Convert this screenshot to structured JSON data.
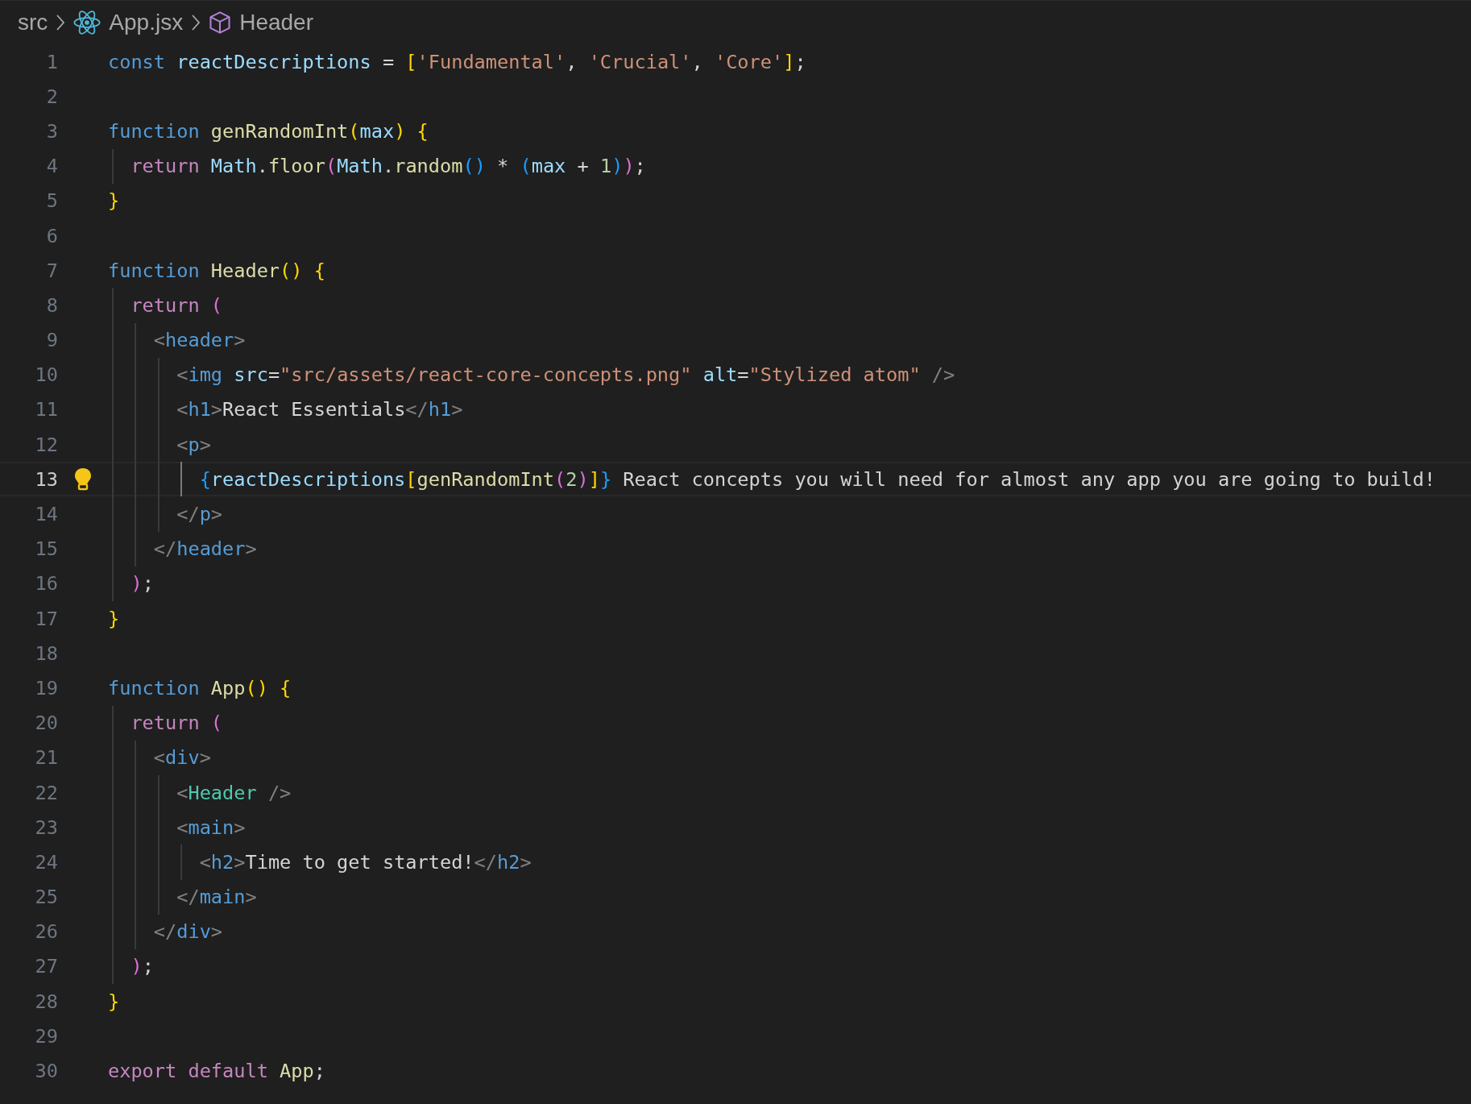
{
  "breadcrumb": [
    {
      "label": "src",
      "kind": "folder"
    },
    {
      "label": "App.jsx",
      "kind": "react-file"
    },
    {
      "label": "Header",
      "kind": "symbol"
    }
  ],
  "lines": [
    {
      "number": "1",
      "current": false,
      "lightbulb": false,
      "tokens": [
        {
          "text": "const ",
          "kind": "kw"
        },
        {
          "text": "reactDescriptions",
          "kind": "var"
        },
        {
          "text": " = ",
          "kind": "op"
        },
        {
          "text": "[",
          "kind": "b1"
        },
        {
          "text": "'Fundamental'",
          "kind": "str"
        },
        {
          "text": ", ",
          "kind": "op"
        },
        {
          "text": "'Crucial'",
          "kind": "str"
        },
        {
          "text": ", ",
          "kind": "op"
        },
        {
          "text": "'Core'",
          "kind": "str"
        },
        {
          "text": "]",
          "kind": "b1"
        },
        {
          "text": ";",
          "kind": "op"
        }
      ]
    },
    {
      "number": "2",
      "current": false,
      "lightbulb": false
    },
    {
      "number": "3",
      "current": false,
      "lightbulb": false,
      "tokens": [
        {
          "text": "function ",
          "kind": "kw"
        },
        {
          "text": "genRandomInt",
          "kind": "fn"
        },
        {
          "text": "(",
          "kind": "b1"
        },
        {
          "text": "max",
          "kind": "var"
        },
        {
          "text": ") {",
          "kind": "b1"
        }
      ]
    },
    {
      "number": "4",
      "current": false,
      "lightbulb": false,
      "tokens": [
        {
          "text": "  return ",
          "kind": "ctl"
        },
        {
          "text": "Math",
          "kind": "var"
        },
        {
          "text": ".",
          "kind": "op"
        },
        {
          "text": "floor",
          "kind": "fn"
        },
        {
          "text": "(",
          "kind": "b2"
        },
        {
          "text": "Math",
          "kind": "var"
        },
        {
          "text": ".",
          "kind": "op"
        },
        {
          "text": "random",
          "kind": "fn"
        },
        {
          "text": "()",
          "kind": "b3"
        },
        {
          "text": " * ",
          "kind": "op"
        },
        {
          "text": "(",
          "kind": "b3"
        },
        {
          "text": "max",
          "kind": "var"
        },
        {
          "text": " + ",
          "kind": "op"
        },
        {
          "text": "1",
          "kind": "num"
        },
        {
          "text": ")",
          "kind": "b3"
        },
        {
          "text": ")",
          "kind": "b2"
        },
        {
          "text": ";",
          "kind": "op"
        }
      ]
    },
    {
      "number": "5",
      "current": false,
      "lightbulb": false,
      "tokens": [
        {
          "text": "}",
          "kind": "b1"
        }
      ]
    },
    {
      "number": "6",
      "current": false,
      "lightbulb": false
    },
    {
      "number": "7",
      "current": false,
      "lightbulb": false,
      "tokens": [
        {
          "text": "function ",
          "kind": "kw"
        },
        {
          "text": "Header",
          "kind": "fn"
        },
        {
          "text": "() {",
          "kind": "b1"
        }
      ]
    },
    {
      "number": "8",
      "current": false,
      "lightbulb": false,
      "tokens": [
        {
          "text": "  return ",
          "kind": "ctl"
        },
        {
          "text": "(",
          "kind": "b2"
        }
      ]
    },
    {
      "number": "9",
      "current": false,
      "lightbulb": false,
      "tokens": [
        {
          "text": "    <",
          "kind": "tb"
        },
        {
          "text": "header",
          "kind": "tag"
        },
        {
          "text": ">",
          "kind": "tb"
        }
      ]
    },
    {
      "number": "10",
      "current": false,
      "lightbulb": false,
      "tokens": [
        {
          "text": "      <",
          "kind": "tb"
        },
        {
          "text": "img",
          "kind": "tag"
        },
        {
          "text": " src",
          "kind": "attr"
        },
        {
          "text": "=",
          "kind": "op"
        },
        {
          "text": "\"src/assets/react-core-concepts.png\"",
          "kind": "str"
        },
        {
          "text": " alt",
          "kind": "attr"
        },
        {
          "text": "=",
          "kind": "op"
        },
        {
          "text": "\"Stylized atom\"",
          "kind": "str"
        },
        {
          "text": " />",
          "kind": "tb"
        }
      ]
    },
    {
      "number": "11",
      "current": false,
      "lightbulb": false,
      "tokens": [
        {
          "text": "      <",
          "kind": "tb"
        },
        {
          "text": "h1",
          "kind": "tag"
        },
        {
          "text": ">",
          "kind": "tb"
        },
        {
          "text": "React Essentials",
          "kind": "text"
        },
        {
          "text": "</",
          "kind": "tb"
        },
        {
          "text": "h1",
          "kind": "tag"
        },
        {
          "text": ">",
          "kind": "tb"
        }
      ]
    },
    {
      "number": "12",
      "current": false,
      "lightbulb": false,
      "tokens": [
        {
          "text": "      <",
          "kind": "tb"
        },
        {
          "text": "p",
          "kind": "tag"
        },
        {
          "text": ">",
          "kind": "tb"
        }
      ]
    },
    {
      "number": "13",
      "current": true,
      "lightbulb": true,
      "tokens": [
        {
          "text": "        {",
          "kind": "b3"
        },
        {
          "text": "reactDescriptions",
          "kind": "var"
        },
        {
          "text": "[",
          "kind": "b1"
        },
        {
          "text": "genRandomInt",
          "kind": "fn"
        },
        {
          "text": "(",
          "kind": "b2"
        },
        {
          "text": "2",
          "kind": "num"
        },
        {
          "text": ")",
          "kind": "b2"
        },
        {
          "text": "]",
          "kind": "b1"
        },
        {
          "text": "}",
          "kind": "b3"
        },
        {
          "text": " React concepts you will need for almost any app you are going to build!",
          "kind": "text"
        }
      ]
    },
    {
      "number": "14",
      "current": false,
      "lightbulb": false,
      "tokens": [
        {
          "text": "      </",
          "kind": "tb"
        },
        {
          "text": "p",
          "kind": "tag"
        },
        {
          "text": ">",
          "kind": "tb"
        }
      ]
    },
    {
      "number": "15",
      "current": false,
      "lightbulb": false,
      "tokens": [
        {
          "text": "    </",
          "kind": "tb"
        },
        {
          "text": "header",
          "kind": "tag"
        },
        {
          "text": ">",
          "kind": "tb"
        }
      ]
    },
    {
      "number": "16",
      "current": false,
      "lightbulb": false,
      "tokens": [
        {
          "text": "  )",
          "kind": "b2"
        },
        {
          "text": ";",
          "kind": "op"
        }
      ]
    },
    {
      "number": "17",
      "current": false,
      "lightbulb": false,
      "tokens": [
        {
          "text": "}",
          "kind": "b1"
        }
      ]
    },
    {
      "number": "18",
      "current": false,
      "lightbulb": false
    },
    {
      "number": "19",
      "current": false,
      "lightbulb": false,
      "tokens": [
        {
          "text": "function ",
          "kind": "kw"
        },
        {
          "text": "App",
          "kind": "fn"
        },
        {
          "text": "() {",
          "kind": "b1"
        }
      ]
    },
    {
      "number": "20",
      "current": false,
      "lightbulb": false,
      "tokens": [
        {
          "text": "  return ",
          "kind": "ctl"
        },
        {
          "text": "(",
          "kind": "b2"
        }
      ]
    },
    {
      "number": "21",
      "current": false,
      "lightbulb": false,
      "tokens": [
        {
          "text": "    <",
          "kind": "tb"
        },
        {
          "text": "div",
          "kind": "tag"
        },
        {
          "text": ">",
          "kind": "tb"
        }
      ]
    },
    {
      "number": "22",
      "current": false,
      "lightbulb": false,
      "tokens": [
        {
          "text": "      <",
          "kind": "tb"
        },
        {
          "text": "Header",
          "kind": "comp"
        },
        {
          "text": " />",
          "kind": "tb"
        }
      ]
    },
    {
      "number": "23",
      "current": false,
      "lightbulb": false,
      "tokens": [
        {
          "text": "      <",
          "kind": "tb"
        },
        {
          "text": "main",
          "kind": "tag"
        },
        {
          "text": ">",
          "kind": "tb"
        }
      ]
    },
    {
      "number": "24",
      "current": false,
      "lightbulb": false,
      "tokens": [
        {
          "text": "        <",
          "kind": "tb"
        },
        {
          "text": "h2",
          "kind": "tag"
        },
        {
          "text": ">",
          "kind": "tb"
        },
        {
          "text": "Time to get started!",
          "kind": "text"
        },
        {
          "text": "</",
          "kind": "tb"
        },
        {
          "text": "h2",
          "kind": "tag"
        },
        {
          "text": ">",
          "kind": "tb"
        }
      ]
    },
    {
      "number": "25",
      "current": false,
      "lightbulb": false,
      "tokens": [
        {
          "text": "      </",
          "kind": "tb"
        },
        {
          "text": "main",
          "kind": "tag"
        },
        {
          "text": ">",
          "kind": "tb"
        }
      ]
    },
    {
      "number": "26",
      "current": false,
      "lightbulb": false,
      "tokens": [
        {
          "text": "    </",
          "kind": "tb"
        },
        {
          "text": "div",
          "kind": "tag"
        },
        {
          "text": ">",
          "kind": "tb"
        }
      ]
    },
    {
      "number": "27",
      "current": false,
      "lightbulb": false,
      "tokens": [
        {
          "text": "  )",
          "kind": "b2"
        },
        {
          "text": ";",
          "kind": "op"
        }
      ]
    },
    {
      "number": "28",
      "current": false,
      "lightbulb": false,
      "tokens": [
        {
          "text": "}",
          "kind": "b1"
        }
      ]
    },
    {
      "number": "29",
      "current": false,
      "lightbulb": false
    },
    {
      "number": "30",
      "current": false,
      "lightbulb": false,
      "tokens": [
        {
          "text": "export default ",
          "kind": "ctl"
        },
        {
          "text": "App",
          "kind": "fn"
        },
        {
          "text": ";",
          "kind": "op"
        }
      ]
    }
  ]
}
